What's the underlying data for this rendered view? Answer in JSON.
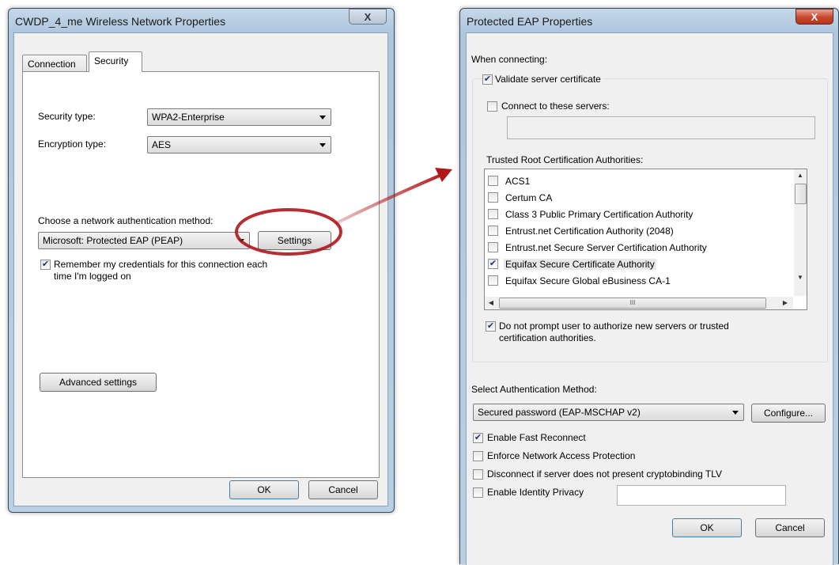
{
  "left_window": {
    "title": "CWDP_4_me Wireless Network Properties",
    "close_glyph": "X",
    "tabs": [
      {
        "label": "Connection"
      },
      {
        "label": "Security"
      }
    ],
    "security_type_label": "Security type:",
    "security_type_value": "WPA2-Enterprise",
    "encryption_type_label": "Encryption type:",
    "encryption_type_value": "AES",
    "auth_method_label": "Choose a network authentication method:",
    "auth_method_value": "Microsoft: Protected EAP (PEAP)",
    "settings_button": "Settings",
    "remember_line1": "Remember my credentials for this connection each",
    "remember_line2": "time I'm logged on",
    "remember_checked": true,
    "advanced_button": "Advanced settings",
    "ok_button": "OK",
    "cancel_button": "Cancel"
  },
  "right_window": {
    "title": "Protected EAP Properties",
    "close_glyph": "X",
    "when_connecting_label": "When connecting:",
    "validate_cert_label": "Validate server certificate",
    "validate_cert_checked": true,
    "connect_servers_label": "Connect to these servers:",
    "connect_servers_checked": false,
    "trusted_root_label": "Trusted Root Certification Authorities:",
    "ca_list": [
      {
        "name": "ACS1",
        "checked": false
      },
      {
        "name": "Certum CA",
        "checked": false
      },
      {
        "name": "Class 3 Public Primary Certification Authority",
        "checked": false
      },
      {
        "name": "Entrust.net Certification Authority (2048)",
        "checked": false
      },
      {
        "name": "Entrust.net Secure Server Certification Authority",
        "checked": false
      },
      {
        "name": "Equifax Secure Certificate Authority",
        "checked": true
      },
      {
        "name": "Equifax Secure Global eBusiness CA-1",
        "checked": false
      }
    ],
    "scroll_glyph": "III",
    "do_not_prompt_line1": "Do not prompt user to authorize new servers or trusted",
    "do_not_prompt_line2": "certification authorities.",
    "do_not_prompt_checked": true,
    "select_auth_label": "Select Authentication Method:",
    "auth_method_value": "Secured password (EAP-MSCHAP v2)",
    "configure_button": "Configure...",
    "options": [
      {
        "label": "Enable Fast Reconnect",
        "checked": true
      },
      {
        "label": "Enforce Network Access Protection",
        "checked": false
      },
      {
        "label": "Disconnect if server does not present cryptobinding TLV",
        "checked": false
      },
      {
        "label": "Enable Identity Privacy",
        "checked": false
      }
    ],
    "ok_button": "OK",
    "cancel_button": "Cancel"
  },
  "colors": {
    "highlight_arrow": "#b0161a",
    "check_mark": "#21337a"
  }
}
